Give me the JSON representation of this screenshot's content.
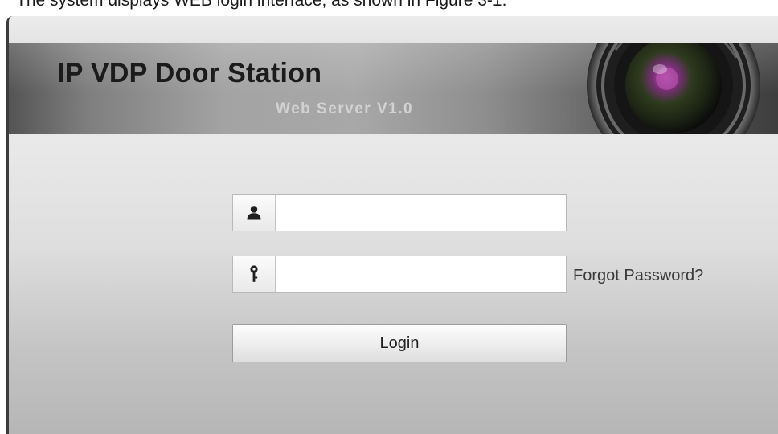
{
  "caption": "The system displays WEB login interface, as shown in Figure 3-1.",
  "banner": {
    "title": "IP VDP Door Station",
    "subtitle": "Web Server V1.0"
  },
  "login": {
    "username_value": "",
    "password_value": "",
    "forgot_password_label": "Forgot Password?",
    "login_button_label": "Login"
  },
  "icons": {
    "user": "user-icon",
    "password": "key-icon",
    "decoration": "camera-lens-icon"
  },
  "colors": {
    "banner_dark": "#3e3e3e",
    "banner_light": "#a8a8a8",
    "title_text": "#1b1b1b",
    "subtitle_text": "#d2d2d2",
    "lens_accent": "#b24fa8"
  }
}
